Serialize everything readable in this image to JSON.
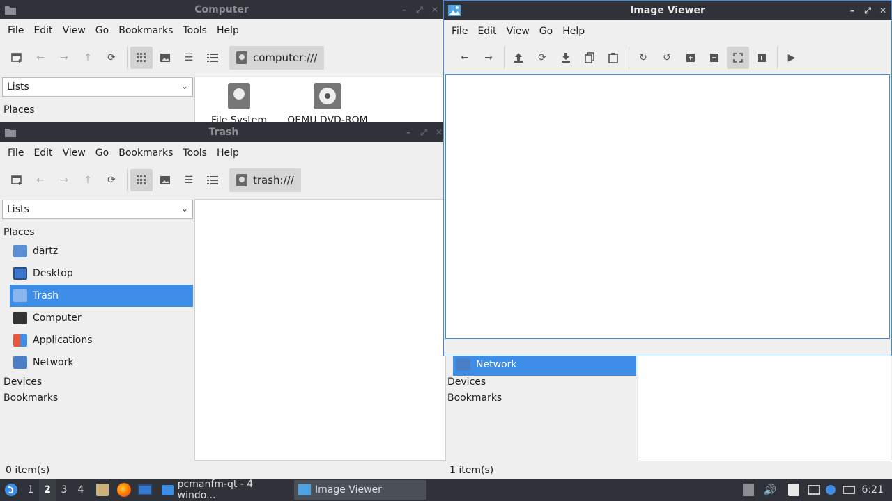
{
  "colors": {
    "accent": "#3e8ee8",
    "titlebar": "#2f3238",
    "panel": "#efefef"
  },
  "menu": [
    "File",
    "Edit",
    "View",
    "Go",
    "Bookmarks",
    "Tools",
    "Help"
  ],
  "computer_window": {
    "title": "Computer",
    "address": "computer:///",
    "side_combo": "Lists",
    "places_label": "Places",
    "devices": [
      "File System",
      "QEMU DVD-ROM"
    ]
  },
  "trash_window": {
    "title": "Trash",
    "address": "trash:///",
    "side_combo": "Lists",
    "places_label": "Places",
    "places": [
      {
        "label": "dartz",
        "icon": "home-folder-icon"
      },
      {
        "label": "Desktop",
        "icon": "desktop-icon"
      },
      {
        "label": "Trash",
        "icon": "trash-icon"
      },
      {
        "label": "Computer",
        "icon": "computer-icon"
      },
      {
        "label": "Applications",
        "icon": "applications-icon"
      },
      {
        "label": "Network",
        "icon": "network-icon"
      }
    ],
    "devices_label": "Devices",
    "bookmarks_label": "Bookmarks",
    "status": "0 item(s)"
  },
  "background_window": {
    "network_label": "Network",
    "devices_label": "Devices",
    "bookmarks_label": "Bookmarks",
    "status": "1 item(s)"
  },
  "image_viewer": {
    "title": "Image Viewer",
    "menu": [
      "File",
      "Edit",
      "View",
      "Go",
      "Help"
    ]
  },
  "taskbar": {
    "workspaces": [
      "1",
      "2",
      "3",
      "4"
    ],
    "current_workspace": "2",
    "tasks": [
      {
        "label": "pcmanfm-qt - 4 windo...",
        "icon": "folder-icon"
      },
      {
        "label": "Image Viewer",
        "icon": "image-viewer-icon"
      }
    ],
    "clock": "6:21"
  }
}
